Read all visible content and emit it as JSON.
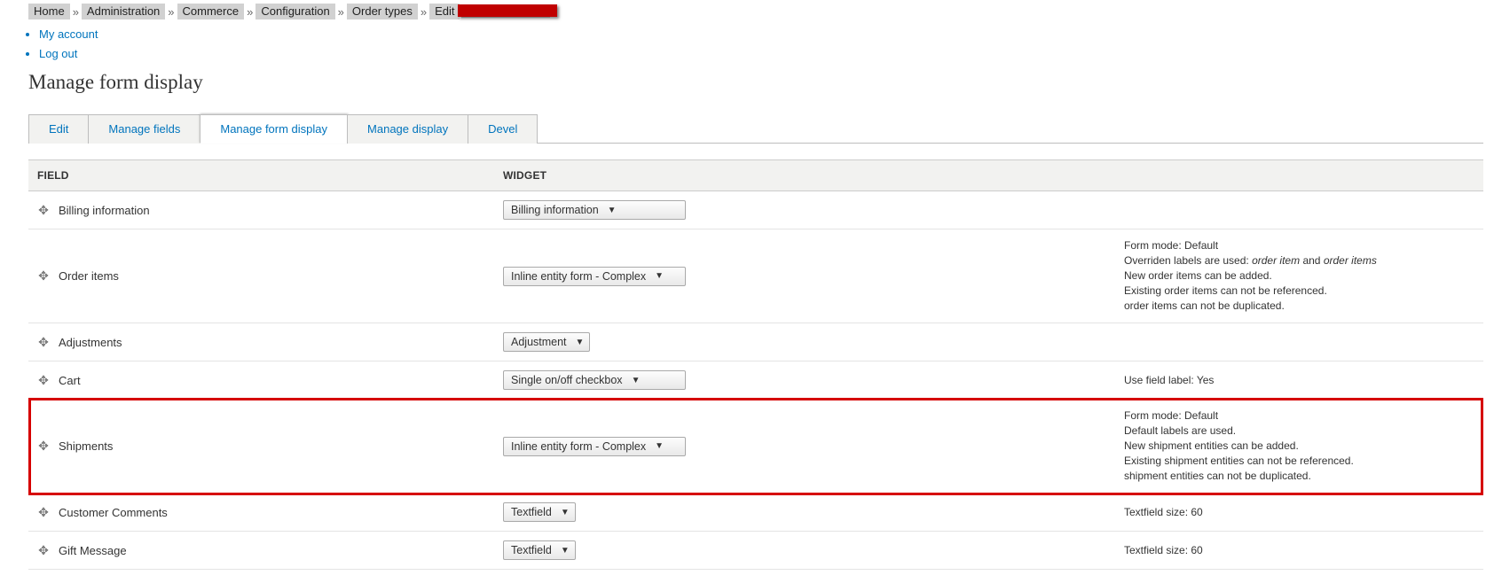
{
  "breadcrumb": {
    "items": [
      "Home",
      "Administration",
      "Commerce",
      "Configuration",
      "Order types",
      "Edit"
    ]
  },
  "user_links": {
    "my_account": "My account",
    "log_out": "Log out"
  },
  "page_title": "Manage form display",
  "tabs": {
    "edit": "Edit",
    "manage_fields": "Manage fields",
    "manage_form_display": "Manage form display",
    "manage_display": "Manage display",
    "devel": "Devel"
  },
  "table": {
    "headers": {
      "field": "FIELD",
      "widget": "WIDGET"
    },
    "rows": [
      {
        "field": "Billing information",
        "widget": "Billing information",
        "summary_lines": []
      },
      {
        "field": "Order items",
        "widget": "Inline entity form - Complex",
        "summary_lines": [
          "Form mode: Default",
          "Overriden labels are used: <em>order item</em> and <em>order items</em>",
          "New order items can be added.",
          "Existing order items can not be referenced.",
          "order items can not be duplicated."
        ]
      },
      {
        "field": "Adjustments",
        "widget": "Adjustment",
        "summary_lines": []
      },
      {
        "field": "Cart",
        "widget": "Single on/off checkbox",
        "summary_lines": [
          "Use field label: Yes"
        ]
      },
      {
        "field": "Shipments",
        "widget": "Inline entity form - Complex",
        "highlight": true,
        "summary_lines": [
          "Form mode: Default",
          "Default labels are used.",
          "New shipment entities can be added.",
          "Existing shipment entities can not be referenced.",
          "shipment entities can not be duplicated."
        ]
      },
      {
        "field": "Customer Comments",
        "widget": "Textfield",
        "summary_lines": [
          "Textfield size: 60"
        ]
      },
      {
        "field": "Gift Message",
        "widget": "Textfield",
        "summary_lines": [
          "Textfield size: 60"
        ]
      }
    ]
  }
}
